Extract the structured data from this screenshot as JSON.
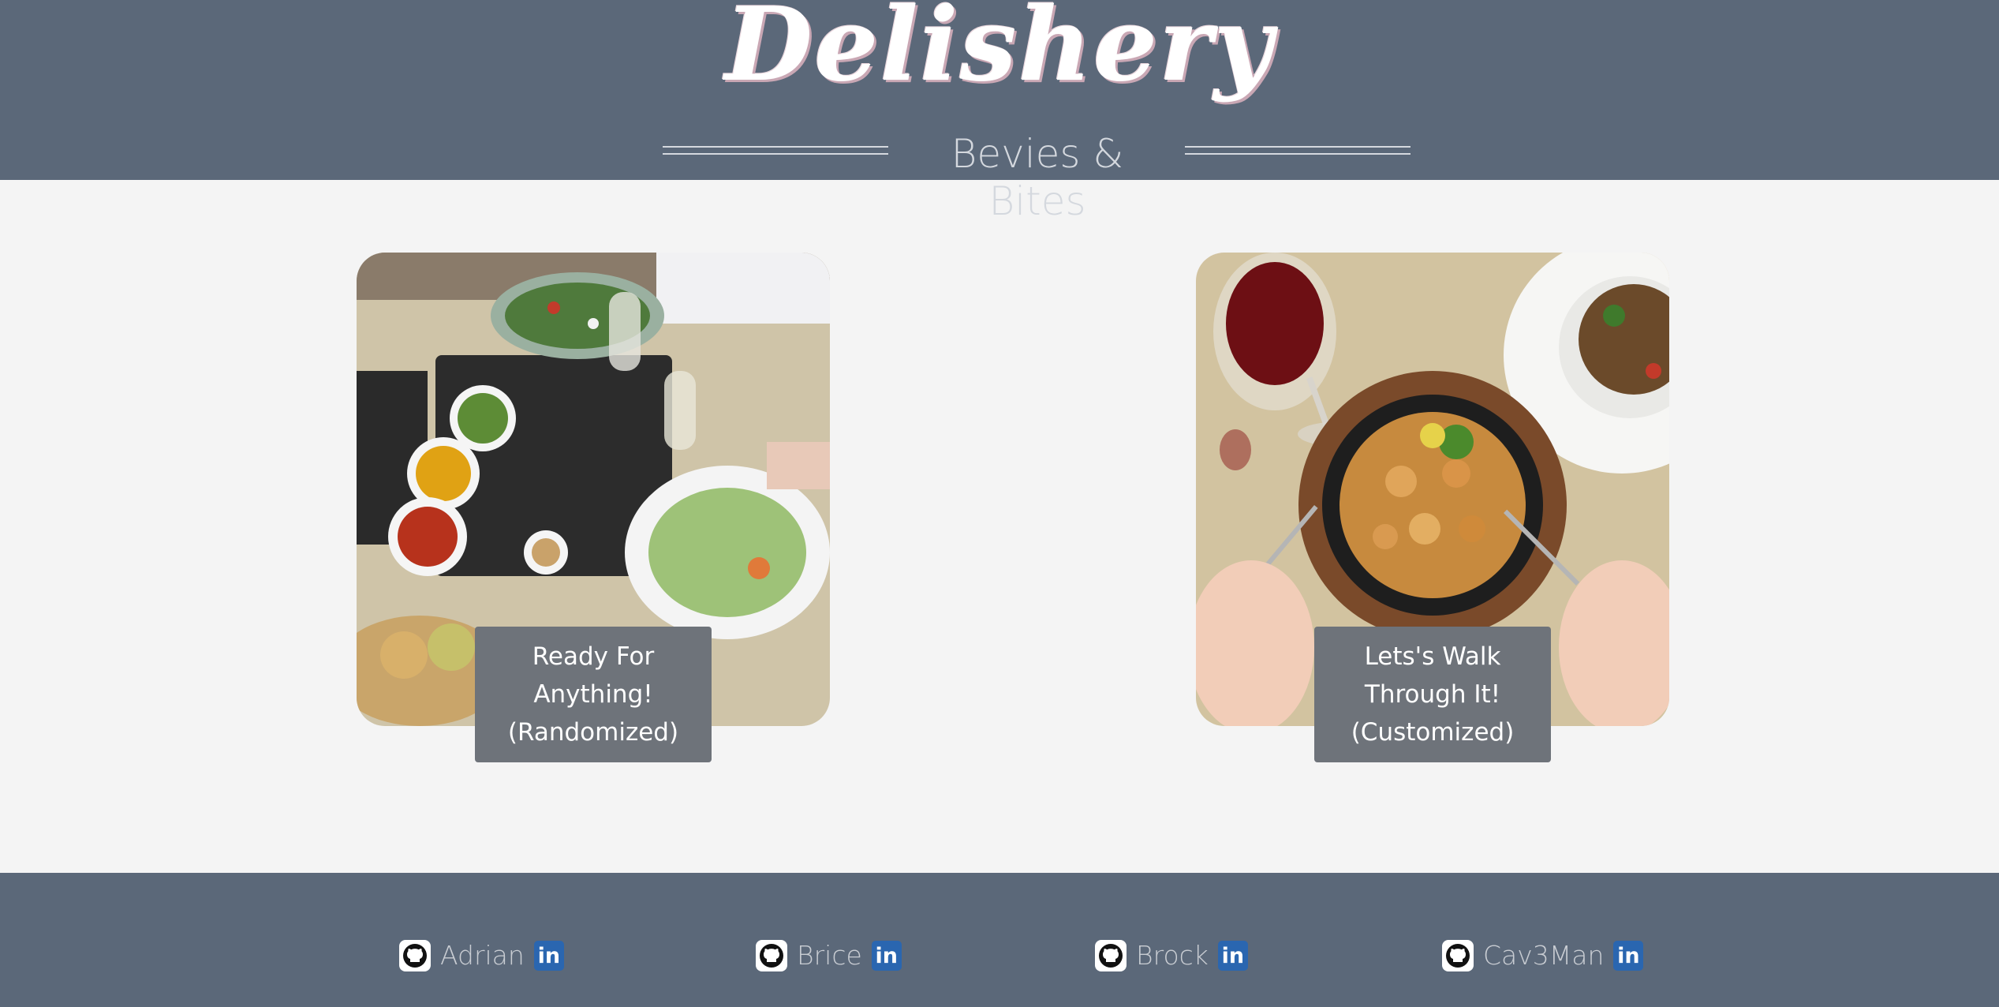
{
  "header": {
    "logo": "Delishery",
    "subtitle": "Bevies & Bites"
  },
  "cards": [
    {
      "caption_lines": [
        "Ready For",
        "Anything!",
        "(Randomized)"
      ]
    },
    {
      "caption_lines": [
        "Lets's Walk",
        "Through It!",
        "(Customized)"
      ]
    }
  ],
  "footer": {
    "members": [
      {
        "name": "Adrian",
        "github_icon": "github-icon",
        "linkedin_icon": "linkedin-icon",
        "linkedin_text": "in"
      },
      {
        "name": "Brice",
        "github_icon": "github-icon",
        "linkedin_icon": "linkedin-icon",
        "linkedin_text": "in"
      },
      {
        "name": "Brock",
        "github_icon": "github-icon",
        "linkedin_icon": "linkedin-icon",
        "linkedin_text": "in"
      },
      {
        "name": "Cav3Man",
        "github_icon": "github-icon",
        "linkedin_icon": "linkedin-icon",
        "linkedin_text": "in"
      }
    ]
  },
  "colors": {
    "header_bg": "#5b6879",
    "page_bg": "#f4f4f4",
    "caption_bg": "#6e737a",
    "linkedin_blue": "#2a66b0"
  }
}
